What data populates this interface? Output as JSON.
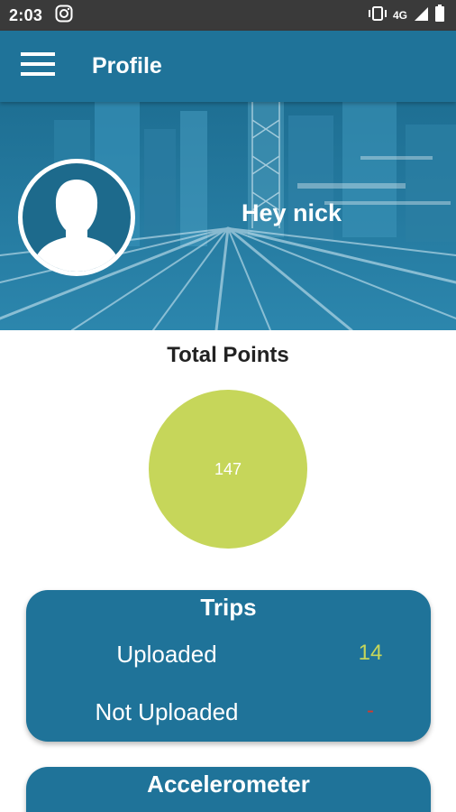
{
  "status_bar": {
    "time": "2:03",
    "network": "4G"
  },
  "app_bar": {
    "title": "Profile"
  },
  "hero": {
    "greeting": "Hey nick"
  },
  "total_points": {
    "title": "Total Points",
    "value": "147"
  },
  "trips": {
    "title": "Trips",
    "rows": [
      {
        "label": "Uploaded",
        "value": "14",
        "value_color": "#c6d65a"
      },
      {
        "label": "Not Uploaded",
        "value": "-",
        "value_color": "#d23a2e"
      }
    ]
  },
  "accelerometer": {
    "title": "Accelerometer"
  },
  "colors": {
    "primary": "#1f7399",
    "accent_green": "#c6d65a",
    "status_bar": "#3a3a3a"
  }
}
